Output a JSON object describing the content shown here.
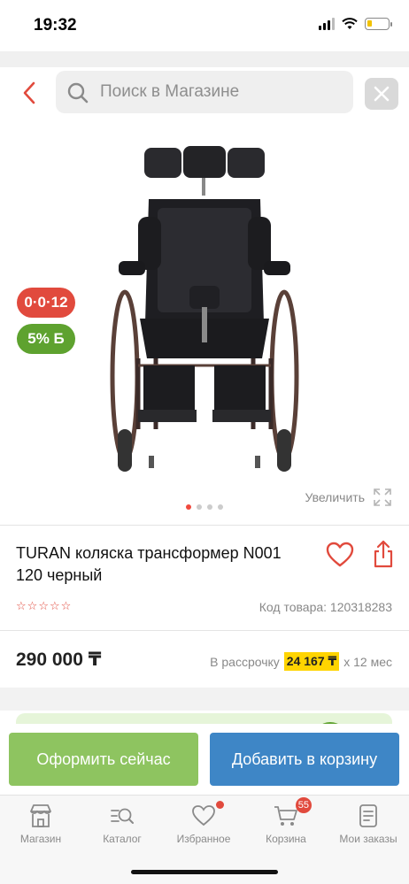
{
  "status": {
    "time": "19:32"
  },
  "search": {
    "placeholder": "Поиск в Магазине"
  },
  "gallery": {
    "badge_installment": "0·0·12",
    "badge_bonus": "5% Б",
    "zoom_label": "Увеличить",
    "slides_total": 4,
    "active_slide": 1
  },
  "product": {
    "title": "TURAN коляска трансформер N001 120 черный",
    "rating_stars": 0,
    "sku_label": "Код товара: 120318283",
    "price": "290 000 ₸",
    "installment_prefix": "В рассрочку",
    "installment_amount": "24 167 ₸",
    "installment_suffix": "х 12 мес"
  },
  "actions": {
    "checkout": "Оформить сейчас",
    "add_to_cart": "Добавить в корзину"
  },
  "tabbar": {
    "items": [
      {
        "label": "Магазин",
        "icon": "store-icon"
      },
      {
        "label": "Каталог",
        "icon": "catalog-search-icon"
      },
      {
        "label": "Избранное",
        "icon": "heart-icon"
      },
      {
        "label": "Корзина",
        "icon": "cart-icon",
        "badge": "55"
      },
      {
        "label": "Мои заказы",
        "icon": "orders-icon"
      }
    ]
  },
  "colors": {
    "accent_red": "#e14a3d",
    "bonus_green": "#5ea22f",
    "checkout_green": "#8ec460",
    "cart_blue": "#3e86c6",
    "installment_yellow": "#ffd400"
  }
}
